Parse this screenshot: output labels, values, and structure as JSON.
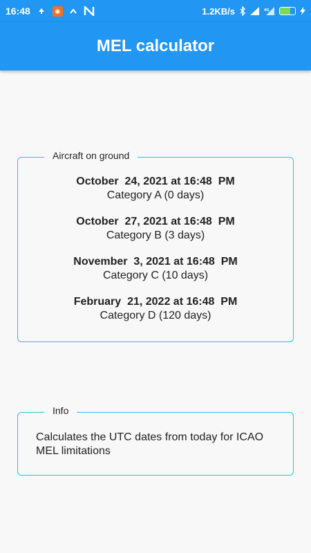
{
  "status_bar": {
    "time": "16:48",
    "net_speed": "1.2KB/s",
    "icons": [
      "cloud-up-icon",
      "app-notification-icon",
      "n-app-icon",
      "bluetooth-icon",
      "signal-icon",
      "4g-signal-icon",
      "battery-icon",
      "charging-icon"
    ],
    "battery_level": 0.7,
    "colors": {
      "bar": "#2196f3",
      "battery": "#7ed957",
      "notification": "#f36f21"
    }
  },
  "app_bar": {
    "title": "MEL calculator",
    "color": "#2196f3"
  },
  "aircraft_card": {
    "legend": "Aircraft on ground",
    "border_color": "#26c6da",
    "entries": [
      {
        "date": "October  24, 2021 at 16:48  PM",
        "category": "Category A (0 days)"
      },
      {
        "date": "October  27, 2021 at 16:48  PM",
        "category": "Category B (3 days)"
      },
      {
        "date": "November  3, 2021 at 16:48  PM",
        "category": "Category C (10 days)"
      },
      {
        "date": "February  21, 2022 at 16:48  PM",
        "category": "Category D (120 days)"
      }
    ]
  },
  "info_card": {
    "legend": "Info",
    "text": "Calculates the UTC dates from today for ICAO MEL limitations"
  }
}
